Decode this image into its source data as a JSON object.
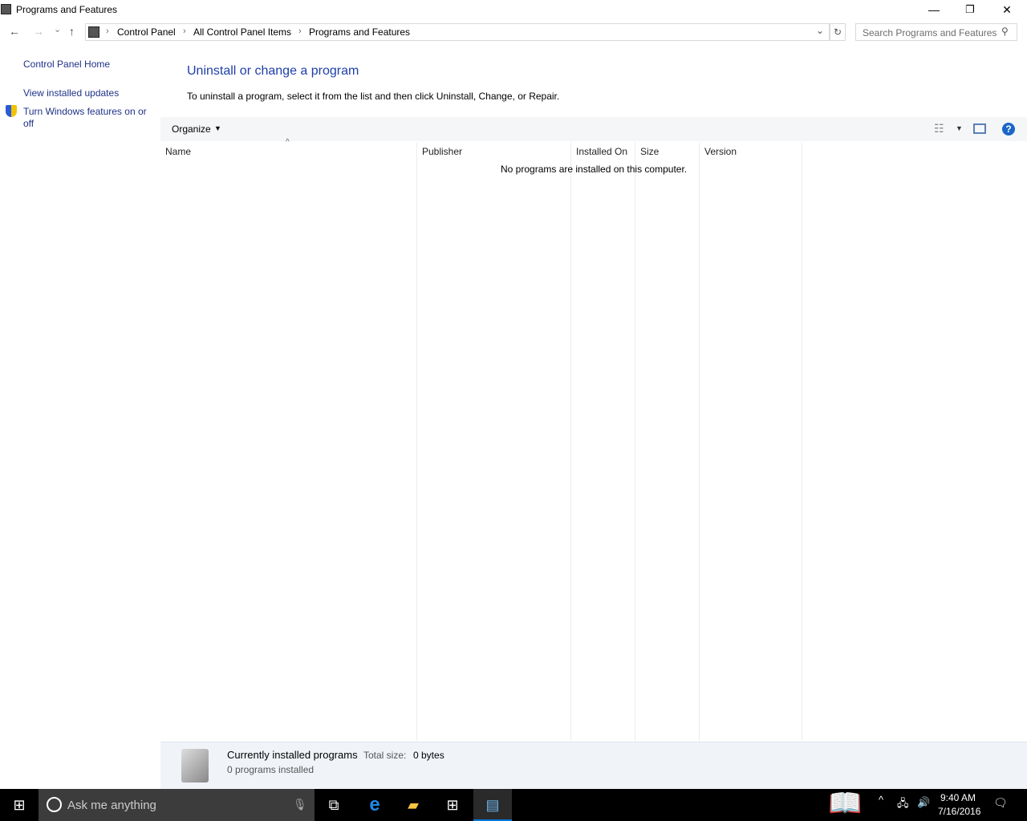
{
  "window": {
    "title": "Programs and Features",
    "minimize": "—",
    "restore": "❐",
    "close": "✕"
  },
  "nav": {
    "back": "←",
    "forward": "→",
    "recent": "⌄",
    "up": "↑"
  },
  "address": {
    "crumbs": [
      "Control Panel",
      "All Control Panel Items",
      "Programs and Features"
    ],
    "separator": "›",
    "dropdown": "⌄",
    "refresh": "↻"
  },
  "search": {
    "placeholder": "Search Programs and Features",
    "icon": "⚲"
  },
  "sidebar": {
    "items": [
      {
        "label": "Control Panel Home"
      },
      {
        "label": "View installed updates"
      },
      {
        "label": "Turn Windows features on or off",
        "icon": "shield-icon"
      }
    ]
  },
  "main": {
    "heading": "Uninstall or change a program",
    "description": "To uninstall a program, select it from the list and then click Uninstall, Change, or Repair.",
    "organize": "Organize",
    "empty_message": "No programs are installed on this computer.",
    "columns": [
      "Name",
      "Publisher",
      "Installed On",
      "Size",
      "Version"
    ],
    "help": "?"
  },
  "details": {
    "title": "Currently installed programs",
    "total_size_label": "Total size:",
    "total_size": "0 bytes",
    "count": "0 programs installed"
  },
  "taskbar": {
    "search_placeholder": "Ask me anything",
    "time": "9:40 AM",
    "date": "7/16/2016",
    "watermark": "The Collection Book",
    "accent": "#0078d7"
  }
}
